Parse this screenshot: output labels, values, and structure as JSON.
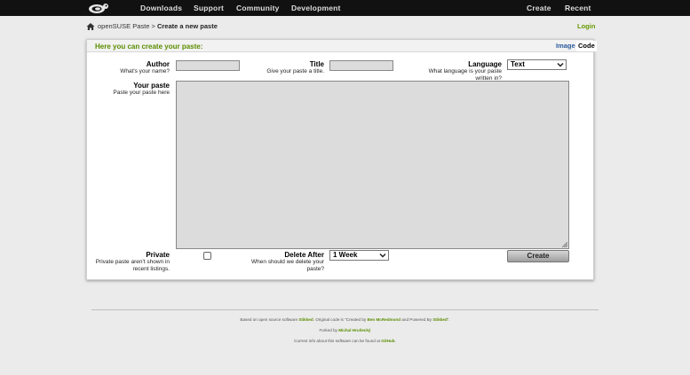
{
  "nav": {
    "items": [
      "Downloads",
      "Support",
      "Community",
      "Development"
    ],
    "right_items": [
      "Create",
      "Recent"
    ]
  },
  "breadcrumb": {
    "site": "openSUSE Paste",
    "separator": ">",
    "current": "Create a new paste"
  },
  "login_label": "Login",
  "panel": {
    "title": "Here you can create your paste:",
    "tabs": [
      "Image",
      "Code"
    ]
  },
  "form": {
    "author": {
      "label": "Author",
      "hint": "What's your name?",
      "value": ""
    },
    "title": {
      "label": "Title",
      "hint": "Give your paste a title.",
      "value": ""
    },
    "language": {
      "label": "Language",
      "hint_line1": "What language is your paste",
      "hint_line2": "written in?",
      "selected": "Text"
    },
    "paste": {
      "label": "Your paste",
      "hint": "Paste your paste here",
      "value": ""
    },
    "private": {
      "label": "Private",
      "hint_line1": "Private paste aren't shown in",
      "hint_line2": "recent listings.",
      "checked": false
    },
    "delete_after": {
      "label": "Delete After",
      "hint_line1": "When should we delete your",
      "hint_line2": "paste?",
      "selected": "1 Week"
    },
    "create_label": "Create"
  },
  "footer": {
    "line1_a": "Based on open source software",
    "line1_link1": "Stikked",
    "line1_b": ". Original code is \"Created by",
    "line1_link2": "Ben McRedmond",
    "line1_c": "and Powered By",
    "line1_link3": "Stikked",
    "line1_d": "\".",
    "line2_a": "Forked by",
    "line2_link": "Michal Hrušecký",
    "line3_a": "Current info about this software can be found at",
    "line3_link": "GitHub",
    "line3_b": "."
  },
  "colors": {
    "accent": "#5a8d00",
    "topbar": "#111111",
    "background": "#ebebeb"
  },
  "icons": [
    "opensuse-logo-icon",
    "home-icon",
    "chevron-down-icon",
    "resize-grip-icon"
  ]
}
